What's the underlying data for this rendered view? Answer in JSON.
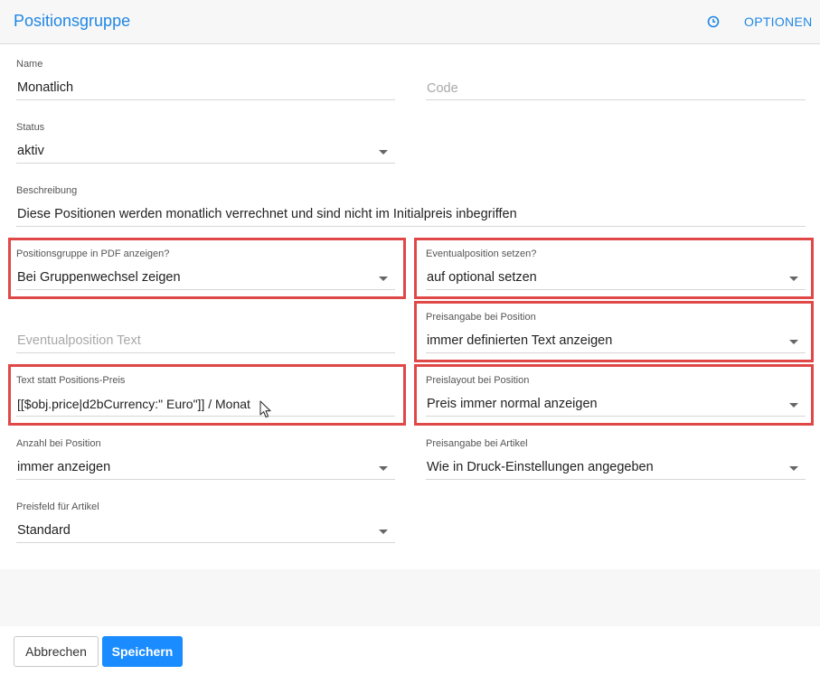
{
  "header": {
    "title": "Positionsgruppe",
    "options_label": "OPTIONEN",
    "icon": "clock-icon"
  },
  "fields": {
    "name": {
      "label": "Name",
      "value": "Monatlich"
    },
    "code": {
      "placeholder": "Code"
    },
    "status": {
      "label": "Status",
      "value": "aktiv"
    },
    "description": {
      "label": "Beschreibung",
      "value": "Diese Positionen werden monatlich verrechnet und sind nicht im Initialpreis inbegriffen"
    },
    "pdf_group": {
      "label": "Positionsgruppe in PDF anzeigen?",
      "value": "Bei Gruppenwechsel zeigen"
    },
    "eventual_position": {
      "label": "Eventualposition setzen?",
      "value": "auf optional setzen"
    },
    "eventual_text": {
      "placeholder": "Eventualposition Text"
    },
    "price_info_position": {
      "label": "Preisangabe bei Position",
      "value": "immer definierten Text anzeigen"
    },
    "text_instead_price": {
      "label": "Text statt Positions-Preis",
      "value": "[[$obj.price|d2bCurrency:\" Euro\"]] / Monat"
    },
    "price_layout_position": {
      "label": "Preislayout bei Position",
      "value": "Preis immer normal anzeigen"
    },
    "quantity_position": {
      "label": "Anzahl bei Position",
      "value": "immer anzeigen"
    },
    "price_info_article": {
      "label": "Preisangabe bei Artikel",
      "value": "Wie in Druck-Einstellungen angegeben"
    },
    "price_field_article": {
      "label": "Preisfeld für Artikel",
      "value": "Standard"
    }
  },
  "footer": {
    "cancel_label": "Abbrechen",
    "save_label": "Speichern"
  },
  "colors": {
    "accent": "#1f87e5",
    "highlight": "#e04848",
    "save_button": "#1a8cff"
  }
}
